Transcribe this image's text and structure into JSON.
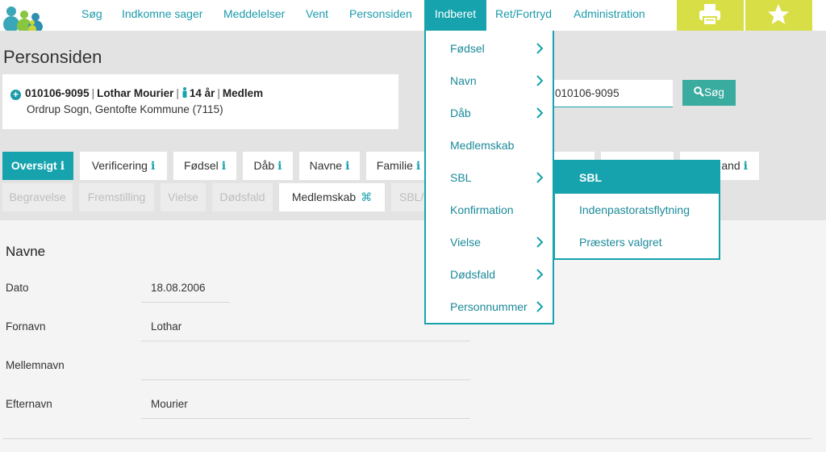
{
  "nav": {
    "items": [
      "Søg",
      "Indkomne sager",
      "Meddelelser",
      "Vent",
      "Personsiden",
      "Indberet",
      "Ret/Fortryd",
      "Administration"
    ],
    "active": "Indberet",
    "print_icon": "printer-icon",
    "favorite_icon": "star-icon"
  },
  "page": {
    "title": "Personsiden"
  },
  "person": {
    "cpr": "010106-9095",
    "name": "Lothar Mourier",
    "age": "14 år",
    "status": "Medlem",
    "address": "Ordrup Sogn, Gentofte Kommune (7115)",
    "separator": "|"
  },
  "search": {
    "value": "010106-9095",
    "button_label": "Søg"
  },
  "tabs": {
    "row1": [
      "Oversigt",
      "Verificering",
      "Fødsel",
      "Dåb",
      "Navne",
      "Familie",
      "and"
    ],
    "row2": [
      "Begravelse",
      "Fremstilling",
      "Vielse",
      "Dødsfald",
      "Medlemskab",
      "SBL/"
    ]
  },
  "form": {
    "title": "Navne",
    "fields": [
      {
        "label": "Dato",
        "value": "18.08.2006"
      },
      {
        "label": "Fornavn",
        "value": "Lothar"
      },
      {
        "label": "Mellemnavn",
        "value": ""
      },
      {
        "label": "Efternavn",
        "value": "Mourier"
      }
    ]
  },
  "menu": {
    "items": [
      "Fødsel",
      "Navn",
      "Dåb",
      "Medlemskab",
      "SBL",
      "Konfirmation",
      "Vielse",
      "Dødsfald",
      "Personnummer"
    ],
    "submenu": [
      "SBL",
      "Indenpastoratsflytning",
      "Præsters valgret"
    ]
  },
  "colors": {
    "accent": "#17a3ad",
    "yellow": "#d8df46",
    "green": "#3aab9f"
  }
}
